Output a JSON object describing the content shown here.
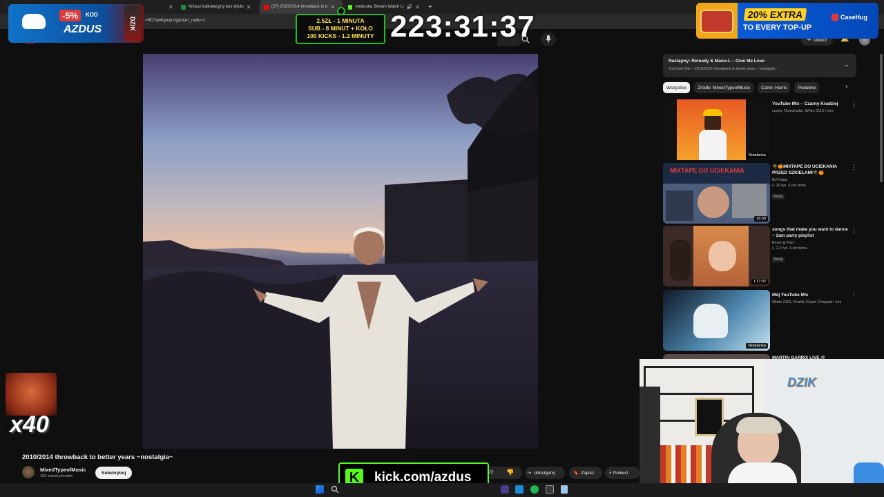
{
  "browser": {
    "tabs": [
      {
        "label": "Arkusz kalkulacyjny bez tytułu",
        "color": "#1e8e3e"
      },
      {
        "label": "(27) 2010/2014 throwback to b",
        "color": "#ff0000"
      },
      {
        "label": "meduska Stream Watch Li",
        "color": "#53fc18"
      }
    ],
    "url": "=RD7qwhgmqrzlg&start_radio=1"
  },
  "overlays": {
    "promo_left": {
      "discount": "-5%",
      "kod": "KOD",
      "code": "AZDUS",
      "brand": "DZIK"
    },
    "promo_right": {
      "extra": "20% EXTRA",
      "line2": "TO EVERY TOP-UP",
      "brand": "CaseHug"
    },
    "timer_rules": [
      "2.5ZŁ - 1 MINUTA",
      "SUB - 8 MINUT + KOŁO",
      "100 KICKS - 1.2 MINUTY"
    ],
    "big_timer": "223:31:37",
    "multiplier": "x40",
    "kick_url": "kick.com/azdus",
    "webcam_logo": "DZIK"
  },
  "youtube": {
    "create_label": "Utwórz",
    "notification_count": "9+",
    "next": {
      "title": "Następny: Remady & Manu-L – Give Me Love",
      "sub": "YouTube Mix – 2010/2014 throwback to better years ~nostalgia~"
    },
    "chips": [
      "Wszystkie",
      "Źródło: MixedTypeofMusic",
      "Calvin Harris",
      "Podobne"
    ],
    "video_title": "2010/2014 throwback to better years ~nostalgia~",
    "channel": {
      "name": "MixedTypeofMusic",
      "subs": "183 subskrybentów",
      "subscribe": "Subskrybuj"
    },
    "actions": {
      "likes": "72",
      "share": "Udostępnij",
      "save": "Zapisz",
      "download": "Pobierz"
    },
    "recommendations": [
      {
        "title": "YouTube Mix – Czarny Kradziej",
        "meta1": "czony, Otsochodzi, White 2115 i inni",
        "meta2": "",
        "badge": "",
        "duration": "Składanka"
      },
      {
        "title": "🌴🍊MIXTAPE DO UCIEKANIA PRZED SZKIELAMI🌴🍊",
        "meta1": "DJ Falda",
        "meta2": "▷ 26 tys.   6 dni temu",
        "badge": "Nowy",
        "duration": "16:30"
      },
      {
        "title": "songs that make you want to dance ~ 2am party playlist",
        "meta1": "Fever & Flair",
        "meta2": "▷ 2,2 tys.   3 dni temu",
        "badge": "Nowy",
        "duration": "1:17:02"
      },
      {
        "title": "Mój YouTube Mix",
        "meta1": "White 2115, Khalid, Ciepłe Chłopaki i inni",
        "meta2": "",
        "badge": "",
        "duration": "Składanka"
      },
      {
        "title": "MARTIN GARRIX LIVE @",
        "meta1": "",
        "meta2": "",
        "badge": "",
        "duration": ""
      }
    ]
  },
  "colors": {
    "kick_green": "#53fc18",
    "yt_bg": "#0f0f0f",
    "timer_green": "#17c41e"
  }
}
